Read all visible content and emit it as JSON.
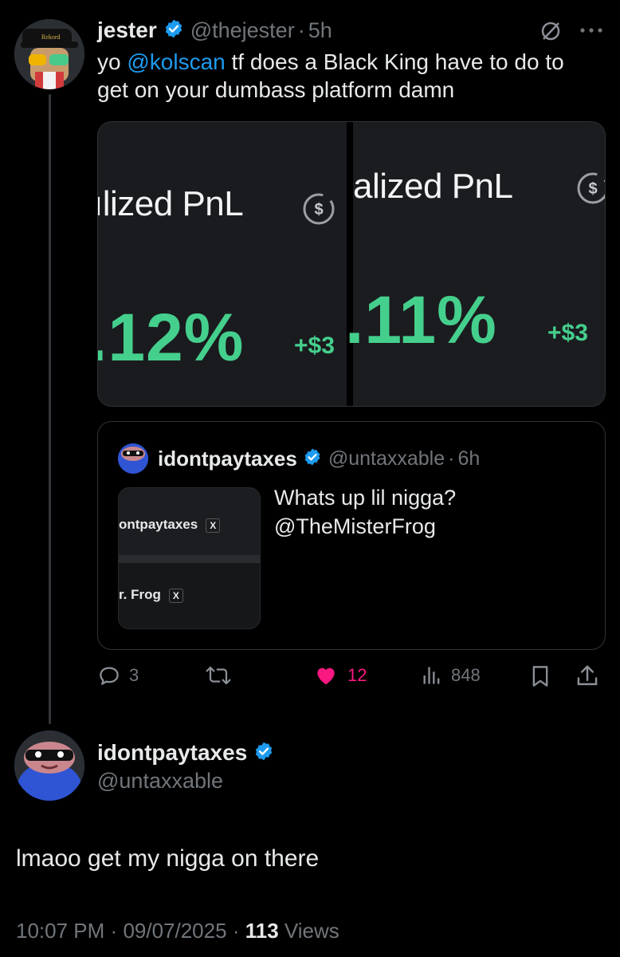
{
  "tweet": {
    "author": {
      "name": "jester",
      "handle": "@thejester",
      "time": "5h",
      "hat_text": "Rekord"
    },
    "text": {
      "prefix": "yo",
      "mention": "@kolscan",
      "rest": "tf does a Black King have to do to",
      "line2": "get on your dumbass platform damn"
    },
    "media": {
      "left_label": "ılized PnL",
      "left_pct": ".12%",
      "left_amt": "+$3",
      "right_label": "alized PnL",
      "right_pct": ".11%",
      "right_amt": "+$3"
    },
    "quote": {
      "name": "idontpaytaxes",
      "handle": "@untaxxable",
      "time": "6h",
      "line1": "Whats up lil nigga?",
      "line2": "@TheMisterFrog",
      "thumb_row1": "ontpaytaxes",
      "thumb_row2": "r. Frog",
      "x_glyph": "X"
    },
    "actions": {
      "replies": "3",
      "likes": "12",
      "views": "848"
    },
    "colors": {
      "like": "#f91880",
      "accent": "#1d9bf0",
      "pnl_green": "#45cf8d"
    }
  },
  "reply": {
    "name": "idontpaytaxes",
    "handle": "@untaxxable",
    "text": "lmaoo get my nigga on there",
    "time": "10:07 PM",
    "date": "09/07/2025",
    "views_count": "113",
    "views_label": "Views"
  },
  "sep": "·"
}
